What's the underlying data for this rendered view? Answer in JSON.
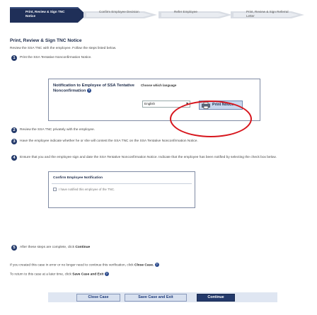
{
  "wizard": {
    "steps": [
      {
        "label": "Print, Review & Sign TNC Notice",
        "active": true
      },
      {
        "label": "Confirm Employee Decision",
        "active": false
      },
      {
        "label": "Refer Employee",
        "active": false
      },
      {
        "label": "Print, Review & Sign Referral Letter",
        "active": false
      }
    ]
  },
  "page": {
    "title": "Print, Review & Sign TNC Notice",
    "intro": "Review the SSA TNC with the employee. Follow the steps listed below."
  },
  "steps": {
    "s1": {
      "num": "1",
      "text": "Print the SSA Tentative Nonconfirmation Notice."
    },
    "s2": {
      "num": "2",
      "text": "Review the SSA TNC privately with the employee."
    },
    "s3": {
      "num": "3",
      "text": "Have the employee indicate whether he or she will contest the SSA TNC on the SSA Tentative Nonconfirmation Notice."
    },
    "s4": {
      "num": "4",
      "text": "Ensure that you and the employee sign and date the SSA Tentative Nonconfirmation Notice. Indicate that the employee has been notified by selecting the check box below."
    },
    "s5": {
      "num": "5",
      "text_before": "After these steps are complete, click",
      "text_bold": "Continue"
    }
  },
  "notice": {
    "heading": "Notification to Employee of SSA Tentative Nonconfirmation",
    "help_glyph": "?",
    "language_label": "Choose which language",
    "language_value": "English",
    "print_button": "Print Notice"
  },
  "confirm": {
    "title": "Confirm Employee Notification",
    "checkbox_label": "I have notified this employee of the TNC."
  },
  "notes": {
    "close_before": "If you created this case in error or no longer need to continue this verification, click",
    "close_bold": "Close Case.",
    "save_before": "To return to this case at a later time, click",
    "save_bold": "Save Case and Exit"
  },
  "buttons": {
    "close": "Close Case",
    "save": "Save Case and Exit",
    "continue": "Continue"
  },
  "colors": {
    "navy": "#243a6b",
    "highlight_red": "#d7161d",
    "button_bg": "#d7e0ef"
  }
}
